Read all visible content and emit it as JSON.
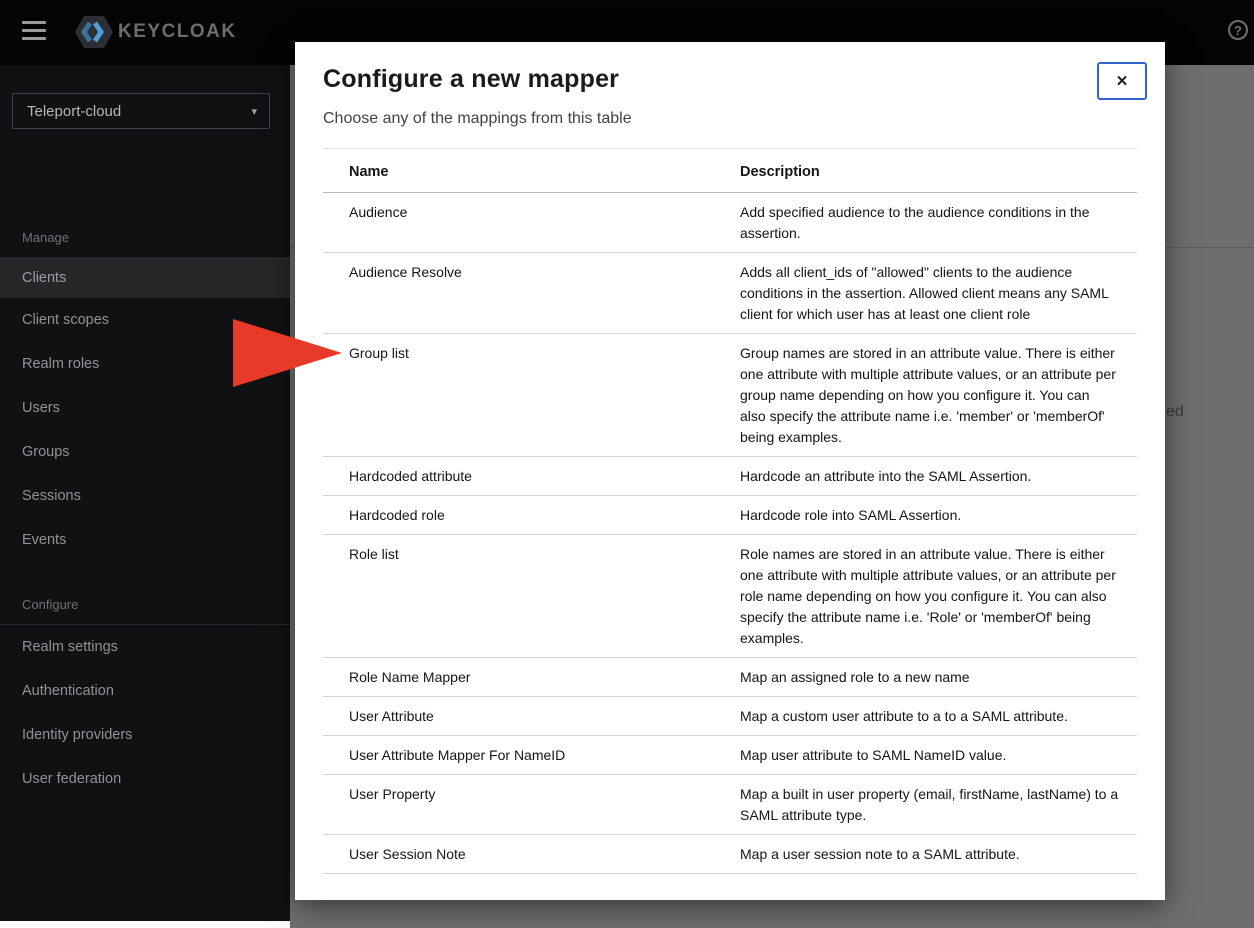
{
  "masthead": {
    "logo_text": "KEYCLOAK",
    "help_label": "?"
  },
  "realm_selector": {
    "value": "Teleport-cloud",
    "caret": "▾"
  },
  "sidebar": {
    "sections": [
      {
        "label": "Manage",
        "items": [
          {
            "label": "Clients",
            "active": true
          },
          {
            "label": "Client scopes",
            "active": false
          },
          {
            "label": "Realm roles",
            "active": false
          },
          {
            "label": "Users",
            "active": false
          },
          {
            "label": "Groups",
            "active": false
          },
          {
            "label": "Sessions",
            "active": false
          },
          {
            "label": "Events",
            "active": false
          }
        ]
      },
      {
        "label": "Configure",
        "items": [
          {
            "label": "Realm settings",
            "active": false
          },
          {
            "label": "Authentication",
            "active": false
          },
          {
            "label": "Identity providers",
            "active": false
          },
          {
            "label": "User federation",
            "active": false
          }
        ]
      }
    ]
  },
  "modal": {
    "title": "Configure a new mapper",
    "subtitle": "Choose any of the mappings from this table",
    "close_label": "✕",
    "table": {
      "columns": [
        "Name",
        "Description"
      ],
      "rows": [
        {
          "name": "Audience",
          "description": "Add specified audience to the audience conditions in the assertion."
        },
        {
          "name": "Audience Resolve",
          "description": "Adds all client_ids of \"allowed\" clients to the audience conditions in the assertion. Allowed client means any SAML client for which user has at least one client role"
        },
        {
          "name": "Group list",
          "description": "Group names are stored in an attribute value. There is either one attribute with multiple attribute values, or an attribute per group name depending on how you configure it. You can also specify the attribute name i.e. 'member' or 'memberOf' being examples."
        },
        {
          "name": "Hardcoded attribute",
          "description": "Hardcode an attribute into the SAML Assertion."
        },
        {
          "name": "Hardcoded role",
          "description": "Hardcode role into SAML Assertion."
        },
        {
          "name": "Role list",
          "description": "Role names are stored in an attribute value. There is either one attribute with multiple attribute values, or an attribute per role name depending on how you configure it. You can also specify the attribute name i.e. 'Role' or 'memberOf' being examples."
        },
        {
          "name": "Role Name Mapper",
          "description": "Map an assigned role to a new name"
        },
        {
          "name": "User Attribute",
          "description": "Map a custom user attribute to a to a SAML attribute."
        },
        {
          "name": "User Attribute Mapper For NameID",
          "description": "Map user attribute to SAML NameID value."
        },
        {
          "name": "User Property",
          "description": "Map a built in user property (email, firstName, lastName) to a SAML attribute type."
        },
        {
          "name": "User Session Note",
          "description": "Map a user session note to a SAML attribute."
        }
      ]
    }
  },
  "background": {
    "fragment_text": "ed"
  },
  "annotation": {
    "arrow_color": "#e83a29"
  },
  "colors": {
    "close_button_border": "#3263cf",
    "masthead_bg": "#040404",
    "sidebar_bg": "#101112",
    "dim_overlay": "#6e6e6e"
  }
}
